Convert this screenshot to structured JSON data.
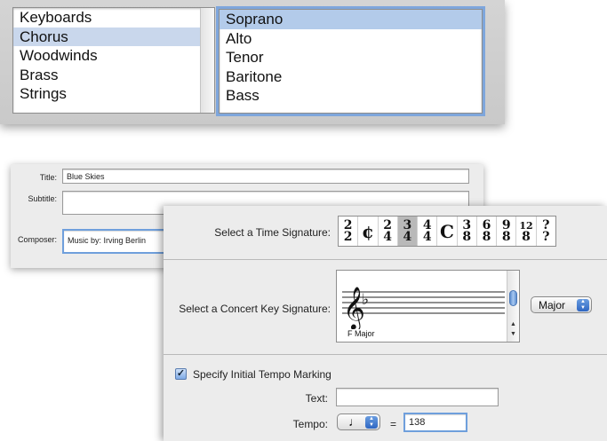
{
  "instrument_families": {
    "items": [
      "Keyboards",
      "Chorus",
      "Woodwinds",
      "Brass",
      "Strings"
    ],
    "selected_index": 1
  },
  "instruments": {
    "items": [
      "Soprano",
      "Alto",
      "Tenor",
      "Baritone",
      "Bass"
    ],
    "selected_index": 0
  },
  "score_info": {
    "title_label": "Title:",
    "title_value": "Blue Skies",
    "subtitle_label": "Subtitle:",
    "subtitle_value": "",
    "composer_label": "Composer:",
    "composer_value": "Music by: Irving Berlin"
  },
  "time_signature": {
    "label": "Select a Time Signature:",
    "options": [
      {
        "top": "2",
        "bottom": "2"
      },
      {
        "symbol": "¢"
      },
      {
        "top": "2",
        "bottom": "4"
      },
      {
        "top": "3",
        "bottom": "4"
      },
      {
        "top": "4",
        "bottom": "4"
      },
      {
        "symbol": "C"
      },
      {
        "top": "3",
        "bottom": "8"
      },
      {
        "top": "6",
        "bottom": "8"
      },
      {
        "top": "9",
        "bottom": "8"
      },
      {
        "top": "12",
        "bottom": "8"
      },
      {
        "top": "?",
        "bottom": "?"
      }
    ],
    "selected_index": 3
  },
  "key_signature": {
    "label": "Select a Concert Key Signature:",
    "key_name": "F Major",
    "mode_selected": "Major",
    "scroll_up": "▲",
    "scroll_down": "▼"
  },
  "tempo": {
    "checkbox_label": "Specify Initial Tempo Marking",
    "checked": true,
    "text_label": "Text:",
    "text_value": "",
    "tempo_label": "Tempo:",
    "beat_unit": "♩",
    "equals": "=",
    "bpm_value": "138"
  },
  "colors": {
    "selection_blue": "#b3cbea",
    "focus_ring": "#6f9fdc",
    "panel_bg": "#ececec"
  }
}
